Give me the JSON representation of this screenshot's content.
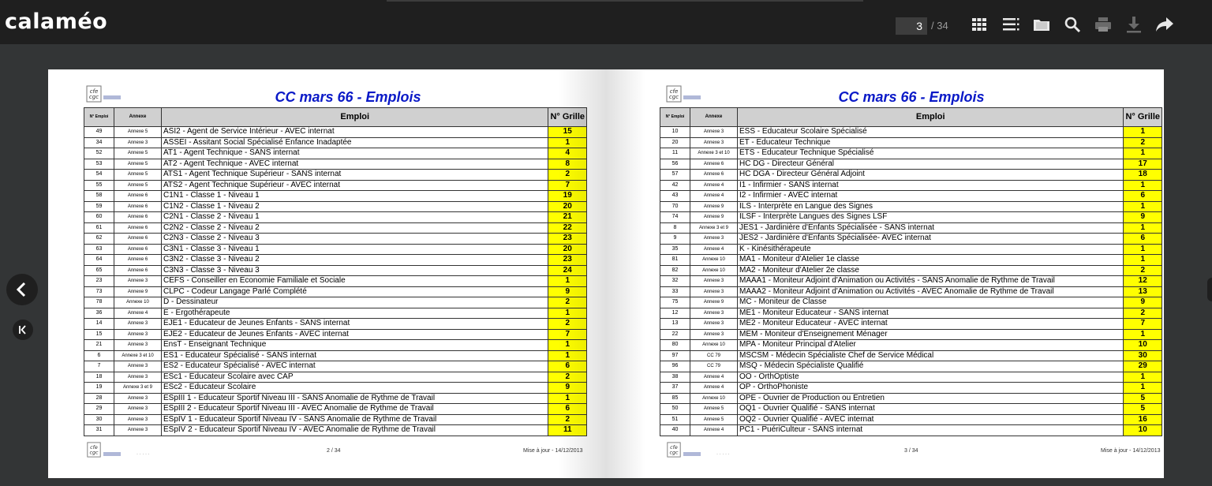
{
  "app": {
    "logo_text": "calaméo"
  },
  "toolbar": {
    "current_page": "3",
    "total_pages": "/ 34",
    "icons": [
      "grid-view-icon",
      "list-view-icon",
      "folder-icon",
      "search-icon",
      "print-icon",
      "download-icon",
      "share-icon"
    ]
  },
  "pages": [
    {
      "title": "CC mars 66 - Emplois",
      "columns": [
        "N° Emploi",
        "Annexe",
        "Emploi",
        "N° Grille"
      ],
      "rows": [
        [
          "49",
          "Annexe 5",
          "ASI2 - Agent de Service Intérieur - AVEC internat",
          "15"
        ],
        [
          "34",
          "Annexe 3",
          "ASSEI - Assitant Social Spécialisé Enfance Inadaptée",
          "1"
        ],
        [
          "52",
          "Annexe 5",
          "AT1 - Agent Technique - SANS internat",
          "4"
        ],
        [
          "53",
          "Annexe 5",
          "AT2 - Agent Technique - AVEC internat",
          "8"
        ],
        [
          "54",
          "Annexe 5",
          "ATS1 - Agent Technique Supérieur - SANS internat",
          "2"
        ],
        [
          "55",
          "Annexe 5",
          "ATS2 - Agent Technique Supérieur - AVEC internat",
          "7"
        ],
        [
          "58",
          "Annexe 6",
          "C1N1 - Classe 1  - Niveau 1",
          "19"
        ],
        [
          "59",
          "Annexe 6",
          "C1N2 - Classe 1  - Niveau 2",
          "20"
        ],
        [
          "60",
          "Annexe 6",
          "C2N1 - Classe 2  - Niveau 1",
          "21"
        ],
        [
          "61",
          "Annexe 6",
          "C2N2 - Classe 2  - Niveau 2",
          "22"
        ],
        [
          "62",
          "Annexe 6",
          "C2N3 - Classe 2  - Niveau 3",
          "23"
        ],
        [
          "63",
          "Annexe 6",
          "C3N1 - Classe 3  - Niveau 1",
          "20"
        ],
        [
          "64",
          "Annexe 6",
          "C3N2 - Classe 3  - Niveau 2",
          "23"
        ],
        [
          "65",
          "Annexe 6",
          "C3N3 - Classe 3  - Niveau 3",
          "24"
        ],
        [
          "23",
          "Annexe 3",
          "CEFS - Conseiller en Economie Familiale et Sociale",
          "1"
        ],
        [
          "73",
          "Annexe 9",
          "CLPC - Codeur Langage Parlé Complété",
          "9"
        ],
        [
          "78",
          "Annexe 10",
          "D - Dessinateur",
          "2"
        ],
        [
          "36",
          "Annexe 4",
          "E - Ergothérapeute",
          "1"
        ],
        [
          "14",
          "Annexe 3",
          "EJE1 - Educateur de Jeunes Enfants - SANS internat",
          "2"
        ],
        [
          "15",
          "Annexe 3",
          "EJE2 - Educateur de Jeunes Enfants - AVEC internat",
          "7"
        ],
        [
          "21",
          "Annexe 3",
          "EnsT - Enseignant Technique",
          "1"
        ],
        [
          "6",
          "Annexe 3 et 10",
          "ES1 - Educateur Spécialisé - SANS internat",
          "1"
        ],
        [
          "7",
          "Annexe 3",
          "ES2 - Educateur Spécialisé - AVEC internat",
          "6"
        ],
        [
          "18",
          "Annexe 3",
          "ESc1 - Educateur Scolaire avec CAP",
          "2"
        ],
        [
          "19",
          "Annexe 3 et 9",
          "ESc2 - Educateur Scolaire",
          "9"
        ],
        [
          "28",
          "Annexe 3",
          "ESpIII 1 - Educateur Sportif Niveau III  - SANS Anomalie de Rythme de Travail",
          "1"
        ],
        [
          "29",
          "Annexe 3",
          "ESpIII 2 - Educateur Sportif Niveau III  - AVEC Anomalie de Rythme de Travail",
          "6"
        ],
        [
          "30",
          "Annexe 3",
          "ESpIV 1 - Educateur Sportif Niveau IV  - SANS Anomalie de Rythme de Travail",
          "2"
        ],
        [
          "31",
          "Annexe 3",
          "ESpIV 2 - Educateur Sportif Niveau IV  - AVEC Anomalie de Rythme de Travail",
          "11"
        ]
      ],
      "footer_page": "2 / 34",
      "footer_update": "Mise à jour - 14/12/2013"
    },
    {
      "title": "CC mars 66 - Emplois",
      "columns": [
        "N° Emploi",
        "Annexe",
        "Emploi",
        "N° Grille"
      ],
      "rows": [
        [
          "10",
          "Annexe 3",
          "ESS - Educateur Scolaire Spécialisé",
          "1"
        ],
        [
          "20",
          "Annexe 3",
          "ET - Educateur Technique",
          "2"
        ],
        [
          "11",
          "Annexe 3 et 10",
          "ETS - Educateur Technique Spécialisé",
          "1"
        ],
        [
          "56",
          "Annexe 6",
          "HC DG - Directeur Général",
          "17"
        ],
        [
          "57",
          "Annexe 6",
          "HC DGA - Directeur Général Adjoint",
          "18"
        ],
        [
          "42",
          "Annexe 4",
          "I1 - Infirmier - SANS internat",
          "1"
        ],
        [
          "43",
          "Annexe 4",
          "I2 - Infirmier - AVEC internat",
          "6"
        ],
        [
          "70",
          "Annexe 9",
          "ILS - Interprète en Langue des Signes",
          "1"
        ],
        [
          "74",
          "Annexe 9",
          "ILSF - Interprète Langues des Signes LSF",
          "9"
        ],
        [
          "8",
          "Annexe 3 et 9",
          "JES1 - Jardinière d'Enfants Spécialisée - SANS internat",
          "1"
        ],
        [
          "9",
          "Annexe 3",
          "JES2 - Jardinière d'Enfants Spécialisée- AVEC internat",
          "6"
        ],
        [
          "35",
          "Annexe 4",
          "K - Kinésithérapeute",
          "1"
        ],
        [
          "81",
          "Annexe 10",
          "MA1 - Moniteur d'Atelier 1e classe",
          "1"
        ],
        [
          "82",
          "Annexe 10",
          "MA2 - Moniteur d'Atelier 2e classe",
          "2"
        ],
        [
          "32",
          "Annexe 3",
          "MAAA1  - Moniteur Adjoint d'Animation ou Activités - SANS Anomalie de Rythme de Travail",
          "12"
        ],
        [
          "33",
          "Annexe 3",
          "MAAA2  - Moniteur Adjoint d'Animation ou Activités - AVEC Anomalie de Rythme de Travail",
          "13"
        ],
        [
          "75",
          "Annexe 9",
          "MC - Moniteur de Classe",
          "9"
        ],
        [
          "12",
          "Annexe 3",
          "ME1 - Moniteur Educateur - SANS internat",
          "2"
        ],
        [
          "13",
          "Annexe 3",
          "ME2 - Moniteur Educateur - AVEC internat",
          "7"
        ],
        [
          "22",
          "Annexe 3",
          "MEM - Moniteur d'Enseignement Ménager",
          "1"
        ],
        [
          "80",
          "Annexe 10",
          "MPA - Moniteur Principal d'Atelier",
          "10"
        ],
        [
          "97",
          "CC 79",
          "MSCSM - Médecin Spécialiste Chef de Service Médical",
          "30"
        ],
        [
          "96",
          "CC 79",
          "MSQ - Médecin Spécialiste Qualifié",
          "29"
        ],
        [
          "38",
          "Annexe 4",
          "OO - OrthOptiste",
          "1"
        ],
        [
          "37",
          "Annexe 4",
          "OP - OrthoPhoniste",
          "1"
        ],
        [
          "85",
          "Annexe 10",
          "OPE - Ouvrier de Production ou Entretien",
          "5"
        ],
        [
          "50",
          "Annexe 5",
          "OQ1 - Ouvrier Qualifié - SANS internat",
          "5"
        ],
        [
          "51",
          "Annexe 5",
          "OQ2 - Ouvrier Qualifié - AVEC internat",
          "16"
        ],
        [
          "40",
          "Annexe 4",
          "PC1 - PuériCulteur - SANS internat",
          "10"
        ]
      ],
      "footer_page": "3 / 34",
      "footer_update": "Mise à jour - 14/12/2013"
    }
  ]
}
